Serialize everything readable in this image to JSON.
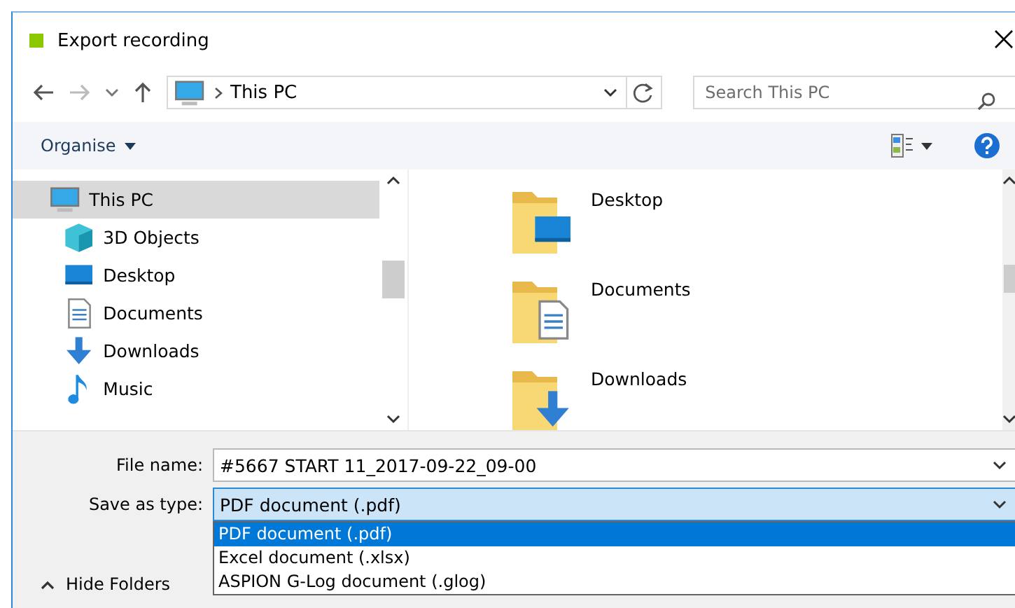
{
  "window": {
    "title": "Export recording"
  },
  "nav": {
    "location": "This PC",
    "search_placeholder": "Search This PC"
  },
  "toolbar": {
    "organise": "Organise"
  },
  "sidebar": {
    "items": [
      {
        "label": "This PC",
        "kind": "pc",
        "selected": true
      },
      {
        "label": "3D Objects",
        "kind": "cube",
        "selected": false
      },
      {
        "label": "Desktop",
        "kind": "desktop",
        "selected": false
      },
      {
        "label": "Documents",
        "kind": "document",
        "selected": false
      },
      {
        "label": "Downloads",
        "kind": "download",
        "selected": false
      },
      {
        "label": "Music",
        "kind": "music",
        "selected": false
      }
    ]
  },
  "folders": [
    {
      "label": "Desktop",
      "kind": "desktop"
    },
    {
      "label": "Documents",
      "kind": "document"
    },
    {
      "label": "Downloads",
      "kind": "download"
    }
  ],
  "form": {
    "file_name_label": "File name:",
    "file_name": "#5667 START 11_2017-09-22_09-00",
    "type_label": "Save as type:",
    "type_value": "PDF document (.pdf)",
    "type_options": [
      {
        "label": "PDF document (.pdf)",
        "selected": true
      },
      {
        "label": "Excel document (.xlsx)",
        "selected": false
      },
      {
        "label": "ASPION G-Log document (.glog)",
        "selected": false
      }
    ]
  },
  "hide_folders": "Hide Folders"
}
